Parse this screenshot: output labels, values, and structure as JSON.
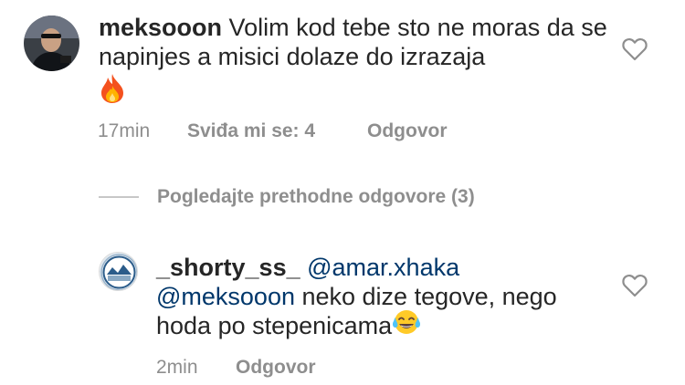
{
  "comment": {
    "username": "meksooon",
    "text": "Volim kod tebe sto ne moras da se napinjes a misici dolaze do izrazaja",
    "emoji": "fire-emoji",
    "time": "17min",
    "likes_label": "Sviđa mi se: 4",
    "reply_label": "Odgovor"
  },
  "view_replies": {
    "label": "Pogledajte prethodne odgovore (3)"
  },
  "reply": {
    "username": "_shorty_ss_",
    "mention_1": "@amar.xhaka",
    "mention_2": "@meksooon",
    "text_part_1": " neko dize tegove, nego",
    "text_part_2": "hoda po stepenicama",
    "emoji": "tears-of-joy-emoji",
    "time": "2min",
    "reply_label": "Odgovor"
  },
  "colors": {
    "text": "#262626",
    "meta": "#8e8e8e",
    "mention": "#00376b",
    "divider": "#c7c7c7"
  }
}
